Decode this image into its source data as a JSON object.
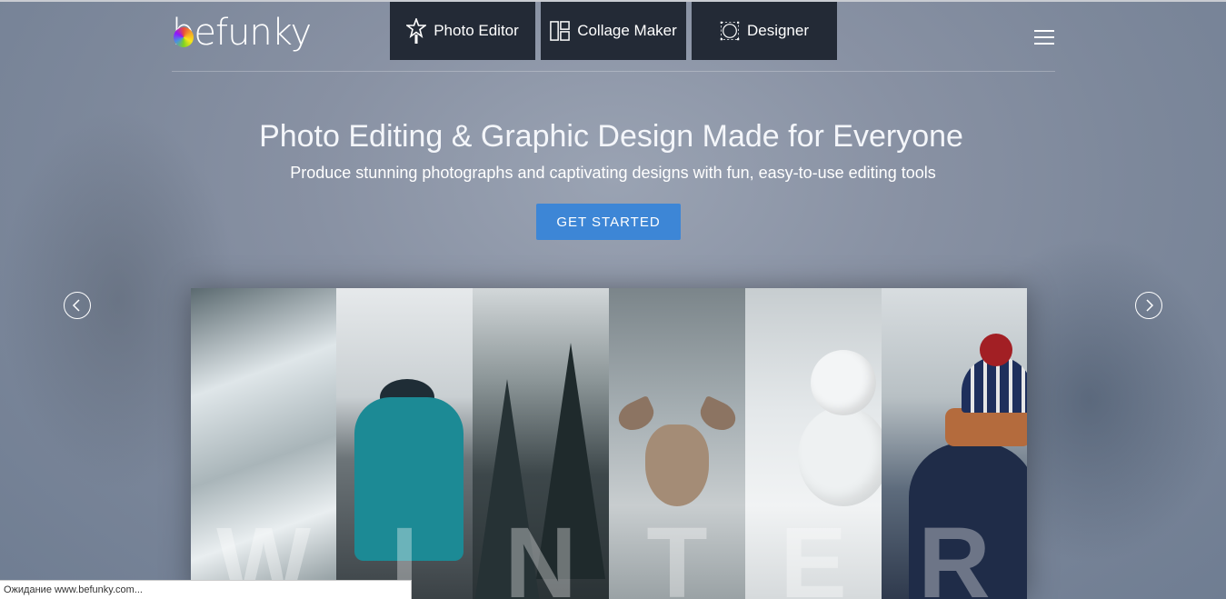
{
  "logo": {
    "text": "befunky"
  },
  "nav": {
    "tabs": [
      {
        "label": "Photo Editor",
        "icon": "magic-wand-icon"
      },
      {
        "label": "Collage Maker",
        "icon": "collage-grid-icon"
      },
      {
        "label": "Designer",
        "icon": "designer-circle-icon"
      }
    ],
    "menu_icon": "hamburger-menu-icon"
  },
  "hero": {
    "title": "Photo Editing & Graphic Design Made for Everyone",
    "subtitle": "Produce stunning photographs and captivating designs with fun, easy-to-use editing tools",
    "cta": "GET STARTED"
  },
  "carousel": {
    "prev_icon": "chevron-left-icon",
    "next_icon": "chevron-right-icon",
    "letters": [
      "W",
      "I",
      "N",
      "T",
      "E",
      "R"
    ]
  },
  "status": {
    "text": "Ожидание www.befunky.com..."
  },
  "colors": {
    "accent": "#3d86d6",
    "nav_bg": "#232a36"
  }
}
